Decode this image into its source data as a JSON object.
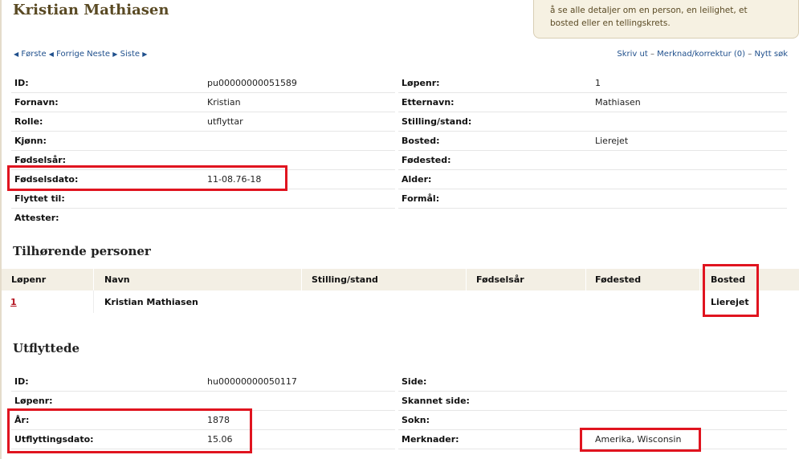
{
  "page": {
    "title": "Kristian Mathiasen",
    "info_text": "å se alle detaljer om en person, en leilighet, et bosted eller en tellingskrets."
  },
  "nav": {
    "first": "Første",
    "previous": "Forrige",
    "next": "Neste",
    "last": "Siste",
    "print": "Skriv ut",
    "remark": "Merknad/korrektur (0)",
    "new_search": "Nytt søk",
    "sep": "–"
  },
  "person": {
    "id_label": "ID:",
    "id_value": "pu00000000051589",
    "lopenr_label": "Løpenr:",
    "lopenr_value": "1",
    "fornavn_label": "Fornavn:",
    "fornavn_value": "Kristian",
    "etternavn_label": "Etternavn:",
    "etternavn_value": "Mathiasen",
    "rolle_label": "Rolle:",
    "rolle_value": "utflyttar",
    "stilling_label": "Stilling/stand:",
    "stilling_value": "",
    "kjonn_label": "Kjønn:",
    "kjonn_value": "",
    "bosted_label": "Bosted:",
    "bosted_value": "Lierejet",
    "fodselsar_label": "Fødselsår:",
    "fodselsar_value": "",
    "fodested_label": "Fødested:",
    "fodested_value": "",
    "fodselsdato_label": "Fødselsdato:",
    "fodselsdato_value": "11-08.76-18",
    "alder_label": "Alder:",
    "alder_value": "",
    "flyttet_label": "Flyttet til:",
    "flyttet_value": "",
    "formal_label": "Formål:",
    "formal_value": "",
    "attester_label": "Attester:",
    "attester_value": ""
  },
  "related": {
    "heading": "Tilhørende personer",
    "columns": [
      "Løpenr",
      "Navn",
      "Stilling/stand",
      "Fødselsår",
      "Fødested",
      "Bosted"
    ],
    "rows": [
      {
        "lopenr": "1",
        "navn": "Kristian Mathiasen",
        "stilling": "",
        "fodselsar": "",
        "fodested": "",
        "bosted": "Lierejet"
      }
    ]
  },
  "emigrated": {
    "heading": "Utflyttede",
    "id_label": "ID:",
    "id_value": "hu00000000050117",
    "side_label": "Side:",
    "side_value": "",
    "lopenr_label": "Løpenr:",
    "lopenr_value": "",
    "skannet_label": "Skannet side:",
    "skannet_value": "",
    "ar_label": "År:",
    "ar_value": "1878",
    "sokn_label": "Sokn:",
    "sokn_value": "",
    "dato_label": "Utflyttingsdato:",
    "dato_value": "15.06",
    "merknader_label": "Merknader:",
    "merknader_value": "Amerika, Wisconsin"
  },
  "colors": {
    "title": "#5a4a24",
    "link": "#1f4f8c",
    "table_link": "#b3121f",
    "table_header_bg": "#f3efe4",
    "highlight": "#e0141f"
  }
}
